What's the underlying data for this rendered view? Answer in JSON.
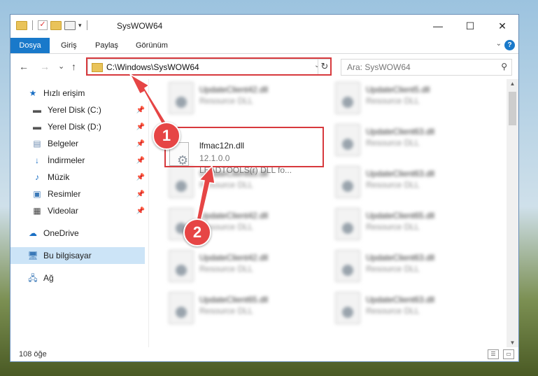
{
  "window": {
    "title": "SysWOW64",
    "qat_dropdown": "▾",
    "minimize": "—",
    "maximize": "☐",
    "close": "✕"
  },
  "ribbon": {
    "tabs": [
      "Dosya",
      "Giriş",
      "Paylaş",
      "Görünüm"
    ],
    "help": "?"
  },
  "nav": {
    "back": "←",
    "forward": "→",
    "recent": "⌄",
    "up": "↑",
    "address": "C:\\Windows\\SysWOW64",
    "search_placeholder": "Ara: SysWOW64"
  },
  "sidebar": {
    "quick_access": "Hızlı erişim",
    "items": [
      {
        "label": "Yerel Disk (C:)",
        "icon": "drive-icon"
      },
      {
        "label": "Yerel Disk (D:)",
        "icon": "drive-icon"
      },
      {
        "label": "Belgeler",
        "icon": "documents-icon"
      },
      {
        "label": "İndirmeler",
        "icon": "download-icon"
      },
      {
        "label": "Müzik",
        "icon": "music-icon"
      },
      {
        "label": "Resimler",
        "icon": "pictures-icon"
      },
      {
        "label": "Videolar",
        "icon": "videos-icon"
      }
    ],
    "onedrive": "OneDrive",
    "this_pc": "Bu bilgisayar",
    "network": "Ağ"
  },
  "files": {
    "highlighted": {
      "name": "lfmac12n.dll",
      "version": "12.1.0.0",
      "description": "LEADTOOLS(r) DLL fo..."
    },
    "left_column": [
      {
        "name": "UpdateClient42.dll",
        "sub": "Resource DLL"
      },
      {
        "name": "UpdateClient65.dll",
        "sub": "Resource DLL"
      },
      {
        "name": "UpdateClient42.dll",
        "sub": "Resource DLL"
      },
      {
        "name": "UpdateClient42.dll",
        "sub": "Resource DLL"
      },
      {
        "name": "UpdateClient65.dll",
        "sub": "Resource DLL"
      }
    ],
    "right_column": [
      {
        "name": "UpdateClient5.dll",
        "sub": "Resource DLL"
      },
      {
        "name": "UpdateClient63.dll",
        "sub": "Resource DLL"
      },
      {
        "name": "UpdateClient63.dll",
        "sub": "Resource DLL"
      },
      {
        "name": "UpdateClient65.dll",
        "sub": "Resource DLL"
      },
      {
        "name": "UpdateClient63.dll",
        "sub": "Resource DLL"
      },
      {
        "name": "UpdateClient63.dll",
        "sub": "Resource DLL"
      }
    ]
  },
  "status": {
    "item_count": "108 öğe"
  },
  "annotations": {
    "step1": "1",
    "step2": "2",
    "color": "#e64545"
  }
}
